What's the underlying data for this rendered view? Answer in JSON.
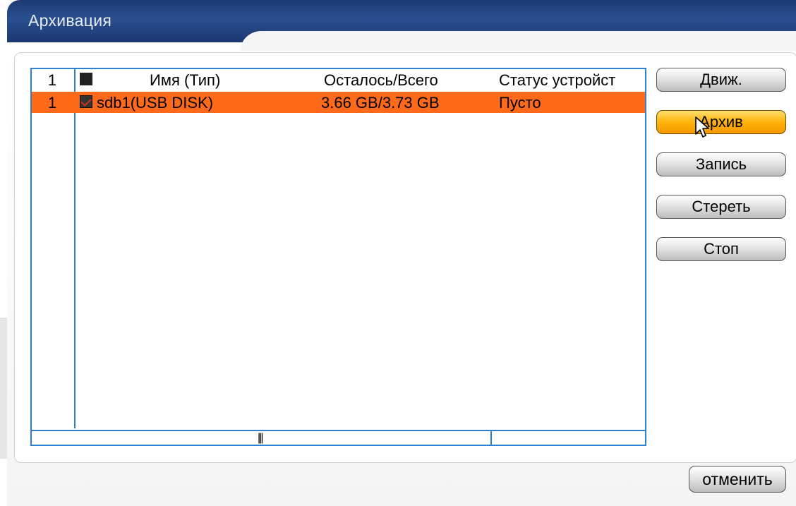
{
  "window": {
    "title": "Архивация"
  },
  "table": {
    "header": {
      "index": "1",
      "name": "Имя (Тип)",
      "space": "Осталось/Всего",
      "status": "Статус устройст"
    },
    "rows": [
      {
        "index": "1",
        "checked": true,
        "name": "sdb1(USB DISK)",
        "space": "3.66 GB/3.73 GB",
        "status": "Пусто",
        "selected": true
      }
    ],
    "scrollbar_grip": "|||"
  },
  "actions": {
    "detect": "Движ.",
    "backup": "Архив",
    "burn": "Запись",
    "erase": "Стереть",
    "stop": "Стоп"
  },
  "footer": {
    "cancel": "отменить"
  },
  "colors": {
    "title_bar": "#1d3a72",
    "table_border": "#2f7fd0",
    "selected_row": "#ff6a1a",
    "active_button": "#ffb20a"
  }
}
